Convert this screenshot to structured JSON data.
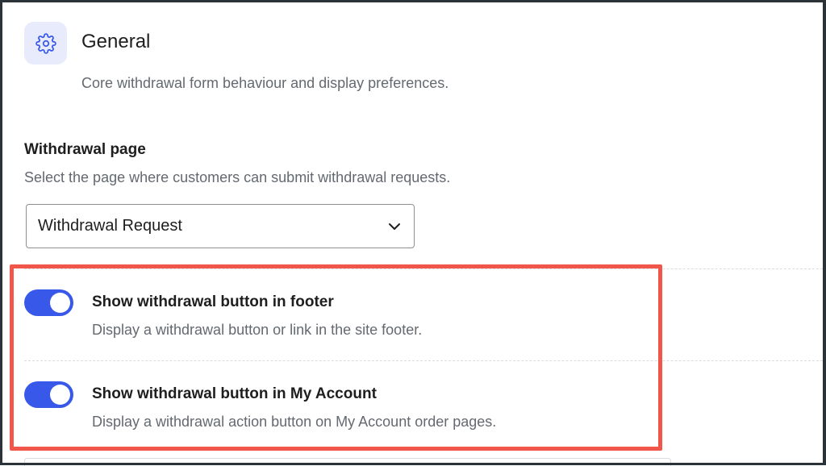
{
  "section": {
    "icon": "gear-icon",
    "title": "General",
    "subtitle": "Core withdrawal form behaviour and display preferences."
  },
  "withdrawal_page": {
    "label": "Withdrawal page",
    "help": "Select the page where customers can submit withdrawal requests.",
    "selected": "Withdrawal Request",
    "dropdown_icon": "chevron-down-icon"
  },
  "options": [
    {
      "title": "Show withdrawal button in footer",
      "description": "Display a withdrawal button or link in the site footer.",
      "enabled": true
    },
    {
      "title": "Show withdrawal button in My Account",
      "description": "Display a withdrawal action button on My Account order pages.",
      "enabled": true
    }
  ],
  "colors": {
    "accent": "#3858e9",
    "highlight": "#f0574a",
    "icon_bg": "#e8ebfb"
  }
}
